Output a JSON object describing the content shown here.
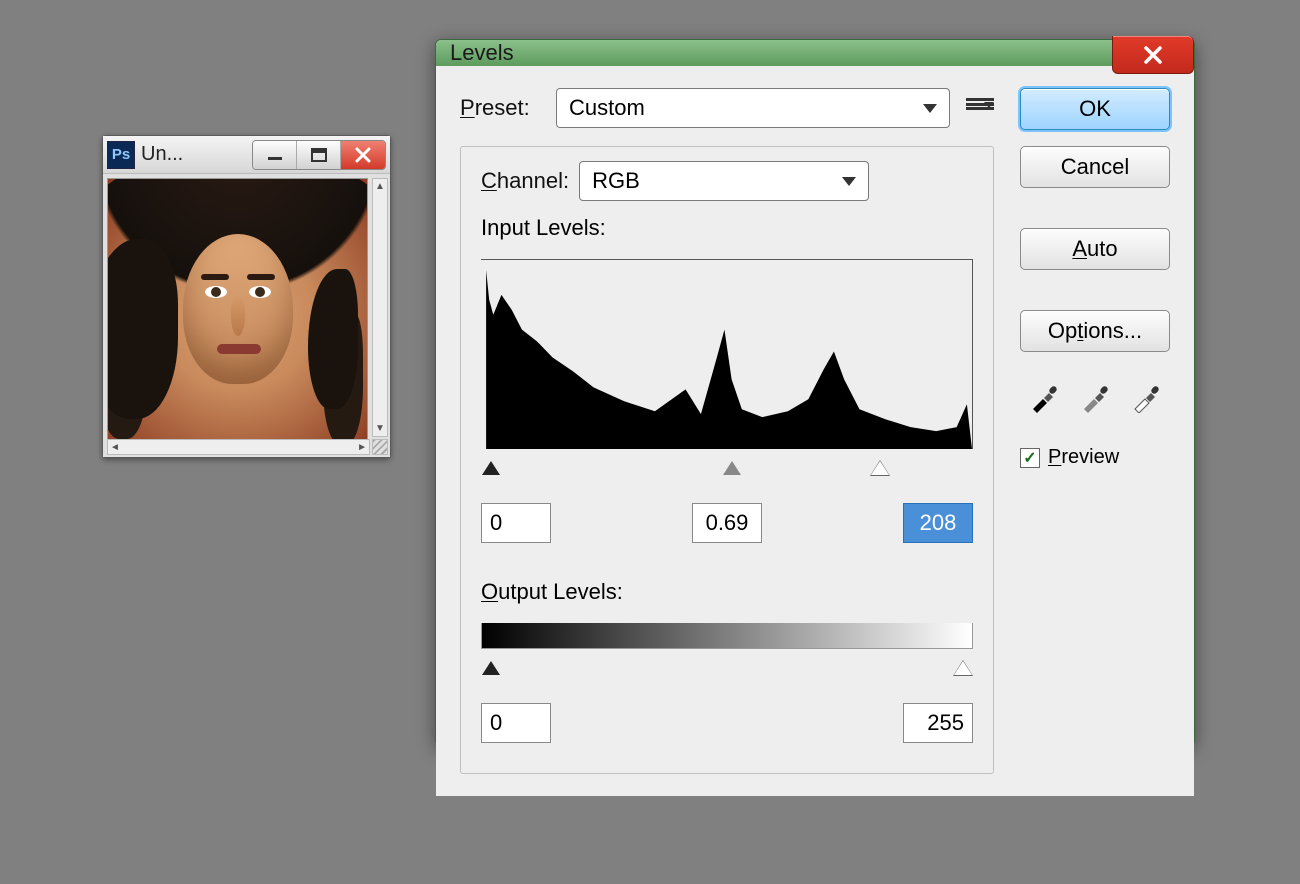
{
  "doc_window": {
    "title": "Un..."
  },
  "levels": {
    "title": "Levels",
    "preset": {
      "label": "Preset:",
      "value": "Custom"
    },
    "channel": {
      "label": "Channel:",
      "value": "RGB"
    },
    "input_levels": {
      "label": "Input Levels:",
      "black": "0",
      "gamma": "0.69",
      "white": "208"
    },
    "output_levels": {
      "label": "Output Levels:",
      "black": "0",
      "white": "255"
    },
    "buttons": {
      "ok": "OK",
      "cancel": "Cancel",
      "auto": "Auto",
      "options": "Options..."
    },
    "preview": {
      "label": "Preview",
      "checked": true
    }
  }
}
